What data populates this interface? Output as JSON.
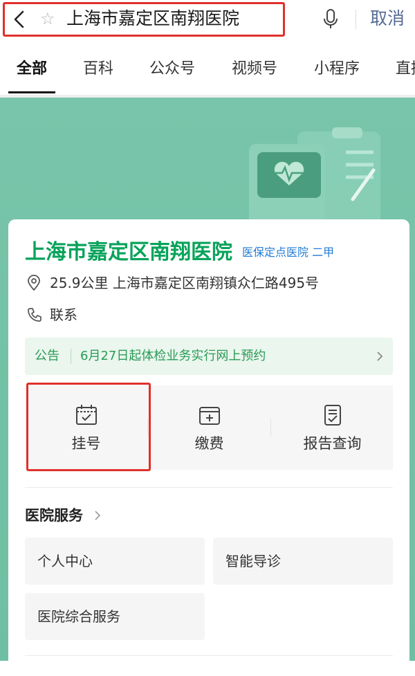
{
  "search": {
    "query": "上海市嘉定区南翔医院",
    "star_glyph": "☆",
    "cancel_label": "取消"
  },
  "tabs": [
    {
      "label": "全部",
      "active": true
    },
    {
      "label": "百科"
    },
    {
      "label": "公众号"
    },
    {
      "label": "视频号"
    },
    {
      "label": "小程序"
    },
    {
      "label": "直播"
    }
  ],
  "hospital": {
    "name": "上海市嘉定区南翔医院",
    "tag": "医保定点医院 二甲",
    "address": "25.9公里 上海市嘉定区南翔镇众仁路495号",
    "contact_label": "联系"
  },
  "notice": {
    "label": "公告",
    "text": "6月27日起体检业务实行网上预约"
  },
  "actions": [
    {
      "label": "挂号",
      "icon": "calendar-check-icon"
    },
    {
      "label": "缴费",
      "icon": "wallet-icon"
    },
    {
      "label": "报告查询",
      "icon": "report-icon"
    }
  ],
  "services": {
    "title": "医院服务",
    "items": [
      "个人中心",
      "智能导诊",
      "医院综合服务"
    ]
  },
  "colors": {
    "accent_green": "#07a35a",
    "banner_green": "#74c2a7",
    "link_blue": "#576b95",
    "tag_blue": "#1f7bd6",
    "highlight_red": "#e0302a"
  }
}
